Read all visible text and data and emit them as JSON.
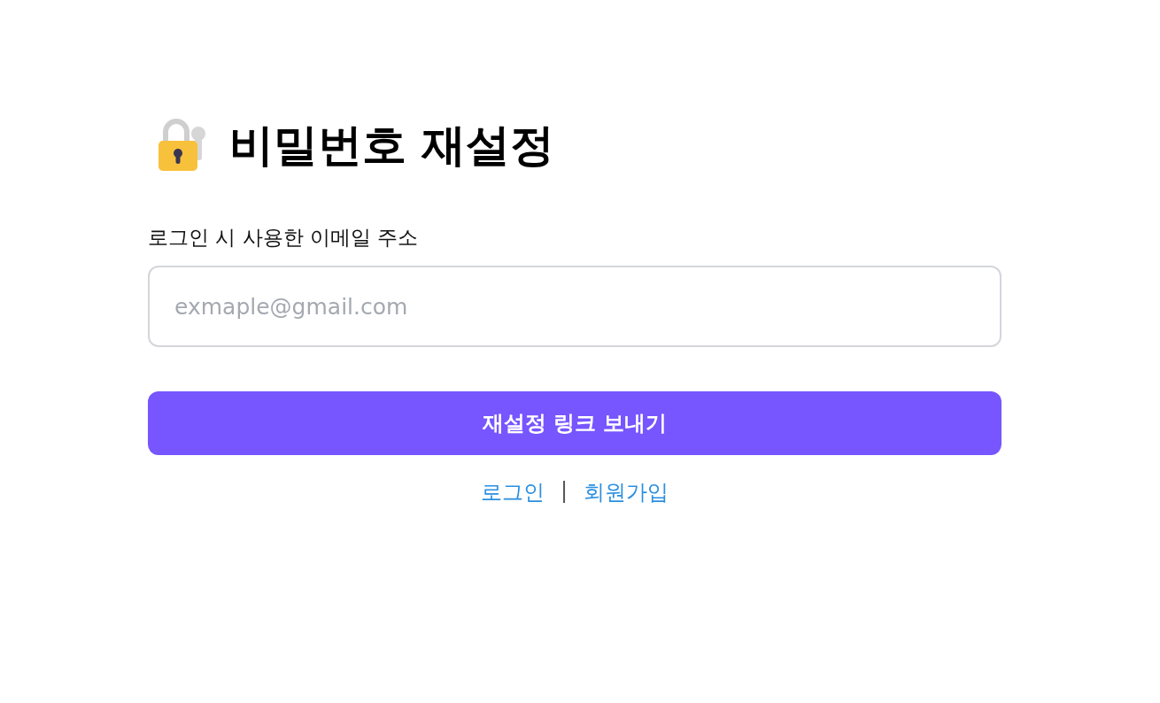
{
  "title": "비밀번호 재설정",
  "email_field": {
    "label": "로그인 시 사용한 이메일 주소",
    "placeholder": "exmaple@gmail.com"
  },
  "submit_button": "재설정 링크 보내기",
  "links": [
    {
      "label": "로그인"
    },
    {
      "label": "회원가입"
    }
  ],
  "separator": "|"
}
